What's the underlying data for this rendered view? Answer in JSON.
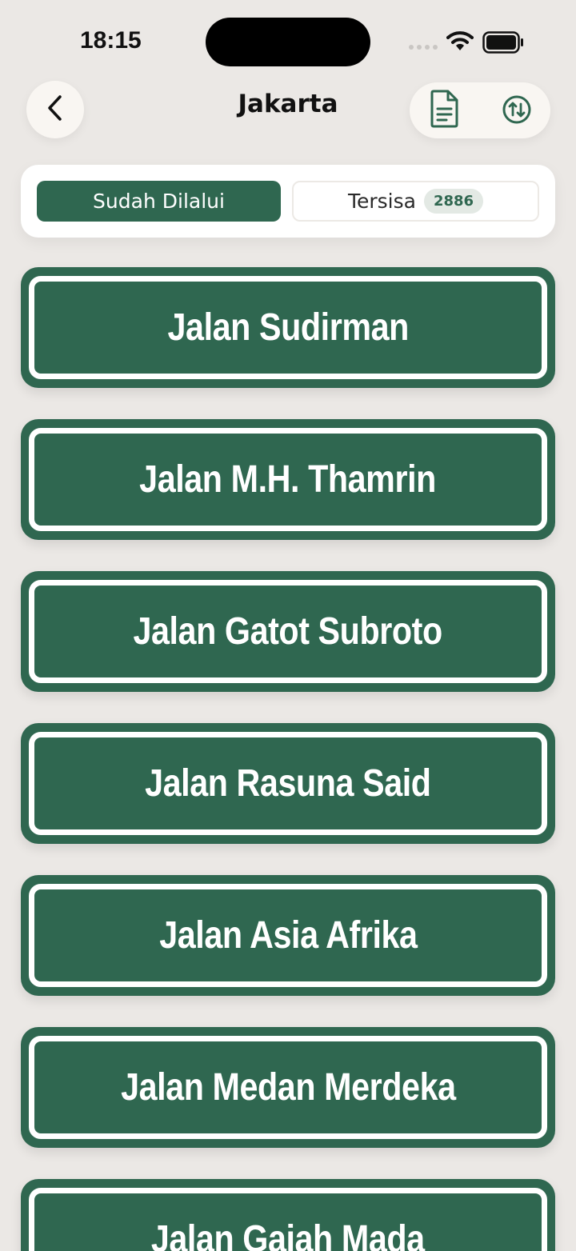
{
  "status_bar": {
    "time": "18:15",
    "icons": [
      "signal-dots-icon",
      "wifi-icon",
      "battery-icon"
    ]
  },
  "header": {
    "title": "Jakarta",
    "back_icon": "chevron-left-icon",
    "actions": [
      "document-icon",
      "sort-arrows-icon"
    ]
  },
  "segments": {
    "active_label": "Sudah Dilalui",
    "inactive_label": "Tersisa",
    "inactive_count": "2886"
  },
  "streets": [
    "Jalan Sudirman",
    "Jalan M.H. Thamrin",
    "Jalan Gatot Subroto",
    "Jalan Rasuna Said",
    "Jalan Asia Afrika",
    "Jalan Medan Merdeka",
    "Jalan Gajah Mada"
  ],
  "colors": {
    "accent": "#2f6750",
    "background": "#ebe8e5",
    "surface": "#ffffff"
  }
}
